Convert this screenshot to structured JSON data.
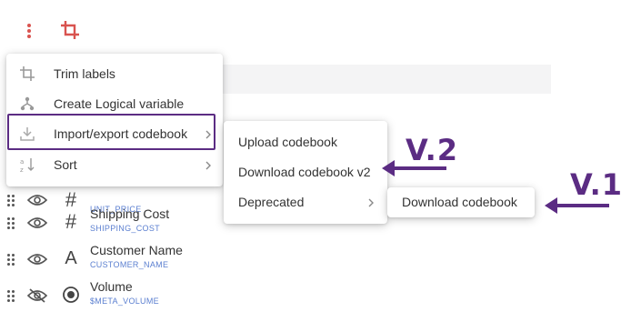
{
  "toolbar": {
    "more_icon": "vertical-dots-icon",
    "crop_icon": "crop-icon"
  },
  "main_menu": {
    "items": [
      {
        "label": "Trim labels",
        "icon": "crop-icon"
      },
      {
        "label": "Create Logical variable",
        "icon": "merge-icon"
      },
      {
        "label": "Import/export codebook",
        "icon": "download-icon",
        "submenu": true
      },
      {
        "label": "Sort",
        "icon": "sort-az-icon",
        "submenu": true
      }
    ]
  },
  "submenu": {
    "items": [
      {
        "label": "Upload codebook"
      },
      {
        "label": "Download codebook v2"
      },
      {
        "label": "Deprecated",
        "submenu": true
      }
    ]
  },
  "submenu2": {
    "items": [
      {
        "label": "Download codebook"
      }
    ]
  },
  "variables": [
    {
      "name": "",
      "code": "UNIT_PRICE",
      "type": "#",
      "visible": true
    },
    {
      "name": "Shipping Cost",
      "code": "SHIPPING_COST",
      "type": "#",
      "visible": true
    },
    {
      "name": "Customer Name",
      "code": "CUSTOMER_NAME",
      "type": "A",
      "visible": true
    },
    {
      "name": "Volume",
      "code": "$META_VOLUME",
      "type": "radio",
      "visible": false
    }
  ],
  "annotations": {
    "v2": "V.2",
    "v1": "V.1"
  },
  "colors": {
    "accent_red": "#d9534f",
    "annotation_purple": "#5b2c83",
    "code_blue": "#5b7fd0"
  }
}
